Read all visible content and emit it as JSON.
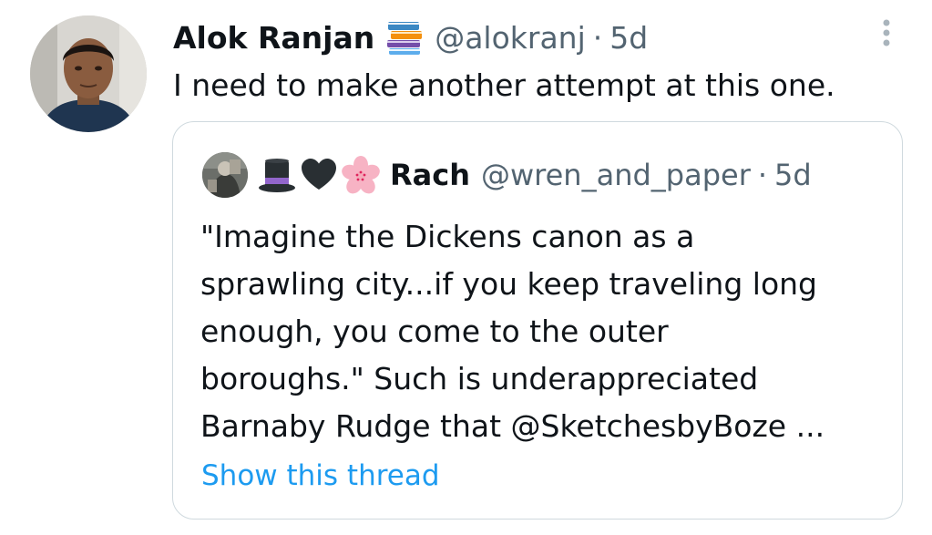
{
  "tweet": {
    "author_name": "Alok Ranjan",
    "handle": "@alokranj",
    "separator": "·",
    "time": "5d",
    "text": "I need to make another attempt at this one.",
    "emoji_icon": "books-emoji-icon"
  },
  "quote": {
    "name": "Rach",
    "handle": "@wren_and_paper",
    "separator": "·",
    "time": "5d",
    "emoji_icons": [
      "top-hat-emoji-icon",
      "black-heart-emoji-icon",
      "cherry-blossom-emoji-icon"
    ],
    "lines": [
      "\"Imagine the Dickens canon as a",
      "sprawling city...if you keep traveling long",
      "enough, you come to the outer",
      "boroughs.\" Such is underappreciated",
      "Barnaby Rudge that @SketchesbyBoze ..."
    ],
    "show_thread": "Show this thread"
  },
  "colors": {
    "text": "#0f1419",
    "secondary": "#536471",
    "link": "#1d9bf0",
    "border": "#cfd9de"
  }
}
